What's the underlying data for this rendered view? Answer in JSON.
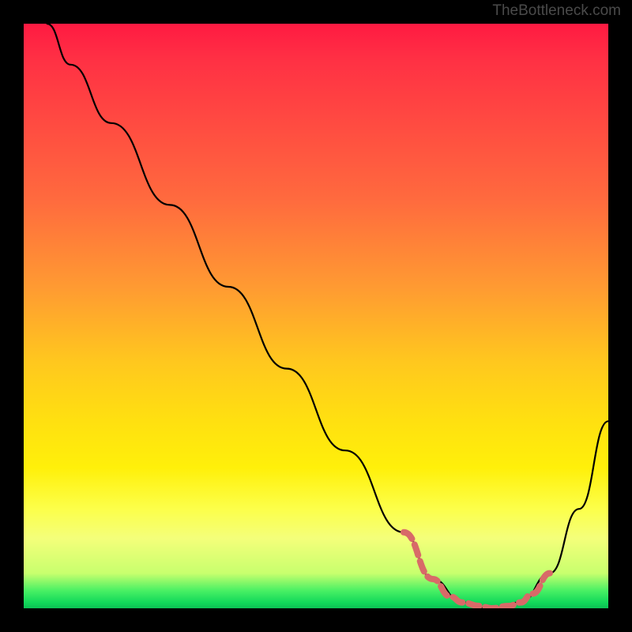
{
  "watermark": "TheBottleneck.com",
  "colors": {
    "background": "#000000",
    "curve": "#000000",
    "marker": "#d86a68",
    "gradient_stops": [
      "#ff1a42",
      "#ff3044",
      "#ff6a3e",
      "#ff9a32",
      "#ffc81e",
      "#ffe010",
      "#fff00a",
      "#fcff4a",
      "#f4ff7a",
      "#c8ff6e",
      "#48f064",
      "#12d85a",
      "#0cc054"
    ]
  },
  "chart_data": {
    "type": "line",
    "title": "",
    "xlabel": "",
    "ylabel": "",
    "xlim": [
      0,
      100
    ],
    "ylim": [
      0,
      100
    ],
    "series": [
      {
        "name": "curve",
        "x": [
          4,
          8,
          15,
          25,
          35,
          45,
          55,
          65,
          70,
          75,
          80,
          85,
          90,
          95,
          100
        ],
        "y": [
          100,
          93,
          83,
          69,
          55,
          41,
          27,
          13,
          5,
          1,
          0,
          1,
          6,
          17,
          32
        ]
      }
    ],
    "highlight_segment": {
      "name": "near-zero-band",
      "x": [
        65,
        70,
        73,
        75,
        78,
        80,
        83,
        85,
        87,
        90
      ],
      "y": [
        13,
        5,
        2,
        1,
        0.4,
        0,
        0.4,
        1,
        2.5,
        6
      ]
    }
  }
}
